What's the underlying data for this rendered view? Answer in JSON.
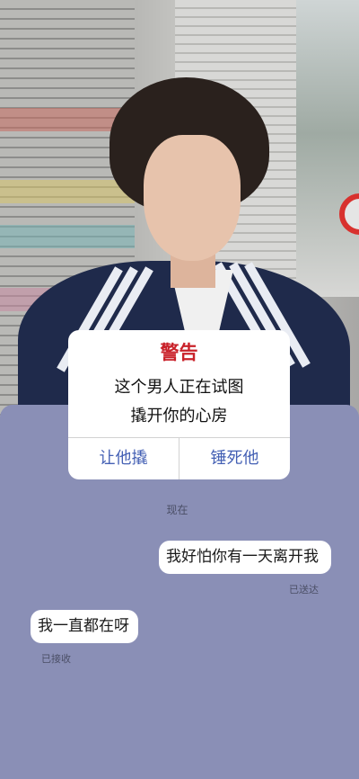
{
  "alert": {
    "title": "警告",
    "message_line1": "这个男人正在试图",
    "message_line2": "撬开你的心房",
    "left_button": "让他撬",
    "right_button": "锤死他"
  },
  "chat": {
    "timestamp": "现在",
    "outgoing": {
      "text": "我好怕你有一天离开我",
      "status": "已送达"
    },
    "incoming": {
      "text": "我一直都在呀",
      "status": "已接收"
    }
  },
  "colors": {
    "panel_background": "#8a8fb6",
    "alert_title": "#c9222a",
    "alert_button": "#4460b4",
    "bubble": "#ffffff"
  }
}
